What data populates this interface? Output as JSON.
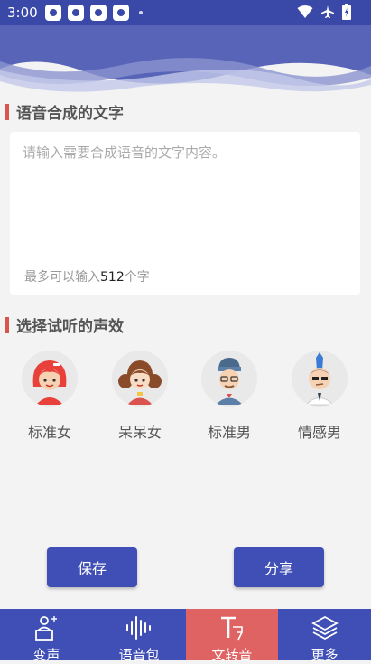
{
  "status_bar": {
    "time": "3:00"
  },
  "text_section": {
    "title": "语音合成的文字",
    "placeholder": "请输入需要合成语音的文字内容。",
    "limit_prefix": "最多可以输入",
    "limit_number": "512",
    "limit_suffix": "个字"
  },
  "voice_section": {
    "title": "选择试听的声效",
    "voices": [
      {
        "label": "标准女",
        "icon": "female-standard-avatar"
      },
      {
        "label": "呆呆女",
        "icon": "female-cute-avatar"
      },
      {
        "label": "标准男",
        "icon": "male-standard-avatar"
      },
      {
        "label": "情感男",
        "icon": "male-emotional-avatar"
      }
    ]
  },
  "actions": {
    "save": "保存",
    "share": "分享"
  },
  "bottom_nav": {
    "items": [
      {
        "label": "变声",
        "icon": "voice-change-icon",
        "active": false
      },
      {
        "label": "语音包",
        "icon": "waveform-icon",
        "active": false
      },
      {
        "label": "文转音",
        "icon": "text-to-speech-icon",
        "active": true
      },
      {
        "label": "更多",
        "icon": "layers-icon",
        "active": false
      }
    ]
  },
  "colors": {
    "primary": "#3f4fb5",
    "accent": "#e06363",
    "background": "#f3f3f3"
  }
}
